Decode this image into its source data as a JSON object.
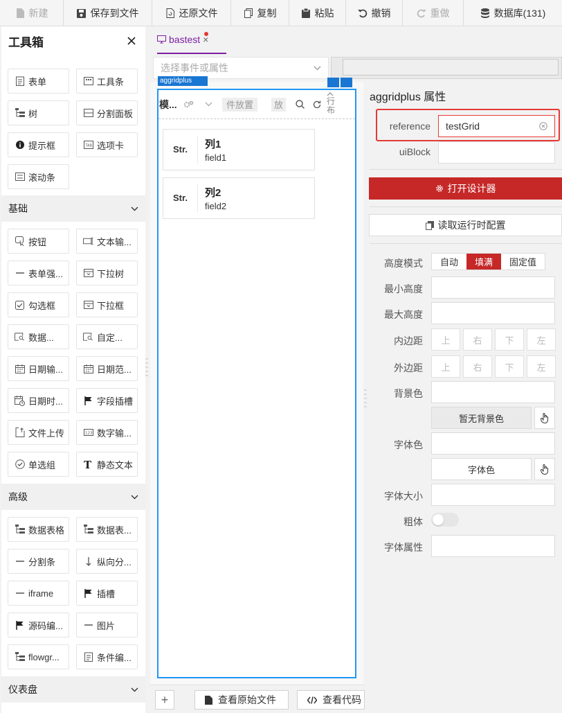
{
  "toolbar": {
    "new": "新建",
    "save_to_file": "保存到文件",
    "restore_file": "还原文件",
    "copy": "复制",
    "paste": "粘贴",
    "undo": "撤销",
    "redo": "重做",
    "database": "数据库(131)"
  },
  "toolbox": {
    "title": "工具箱",
    "top_items": [
      "表单",
      "工具条",
      "树",
      "分割面板",
      "提示框",
      "选项卡",
      "滚动条"
    ],
    "sections": {
      "basic": {
        "title": "基础",
        "items": [
          "按钮",
          "文本输...",
          "表单强...",
          "下拉树",
          "勾选框",
          "下拉框",
          "数据...",
          "自定...",
          "日期输...",
          "日期范...",
          "日期时...",
          "字段插槽",
          "文件上传",
          "数字输...",
          "单选组",
          "静态文本"
        ]
      },
      "advanced": {
        "title": "高级",
        "items": [
          "数据表格",
          "数据表...",
          "分割条",
          "纵向分...",
          "iframe",
          "插槽",
          "源码编...",
          "图片",
          "flowgr...",
          "条件编..."
        ]
      },
      "dashboard": {
        "title": "仪表盘"
      }
    }
  },
  "doc_tab": {
    "label": "bastest",
    "close": "×"
  },
  "event_select": {
    "placeholder": "选择事件或属性"
  },
  "component": {
    "label": "aggridplus",
    "toolbar_title": "模...",
    "btn_place": "件放置",
    "btn_place2": "放",
    "vertical_text": "行布",
    "columns": [
      {
        "type": "Str.",
        "name": "列1",
        "field": "field1"
      },
      {
        "type": "Str.",
        "name": "列2",
        "field": "field2"
      }
    ]
  },
  "bottom_bar": {
    "plus": "+",
    "view_source": "查看原始文件",
    "view_code": "查看代码"
  },
  "props": {
    "title": "aggridplus 属性",
    "reference_label": "reference",
    "reference_value": "testGrid",
    "uiblock_label": "uiBlock",
    "open_designer": "打开设计器",
    "read_runtime": "读取运行时配置",
    "height_mode_label": "高度模式",
    "height_modes": [
      "自动",
      "填满",
      "固定值"
    ],
    "min_height_label": "最小高度",
    "max_height_label": "最大高度",
    "padding_label": "内边距",
    "margin_label": "外边距",
    "sides": [
      "上",
      "右",
      "下",
      "左"
    ],
    "bg_color_label": "背景色",
    "no_bg_color": "暂无背景色",
    "font_color_label": "字体色",
    "font_color_btn": "字体色",
    "font_size_label": "字体大小",
    "bold_label": "粗体",
    "font_attr_label": "字体属性"
  },
  "colors": {
    "accent_red": "#c62828",
    "tab_purple": "#7b1fa2",
    "selection_blue": "#2196f3"
  }
}
